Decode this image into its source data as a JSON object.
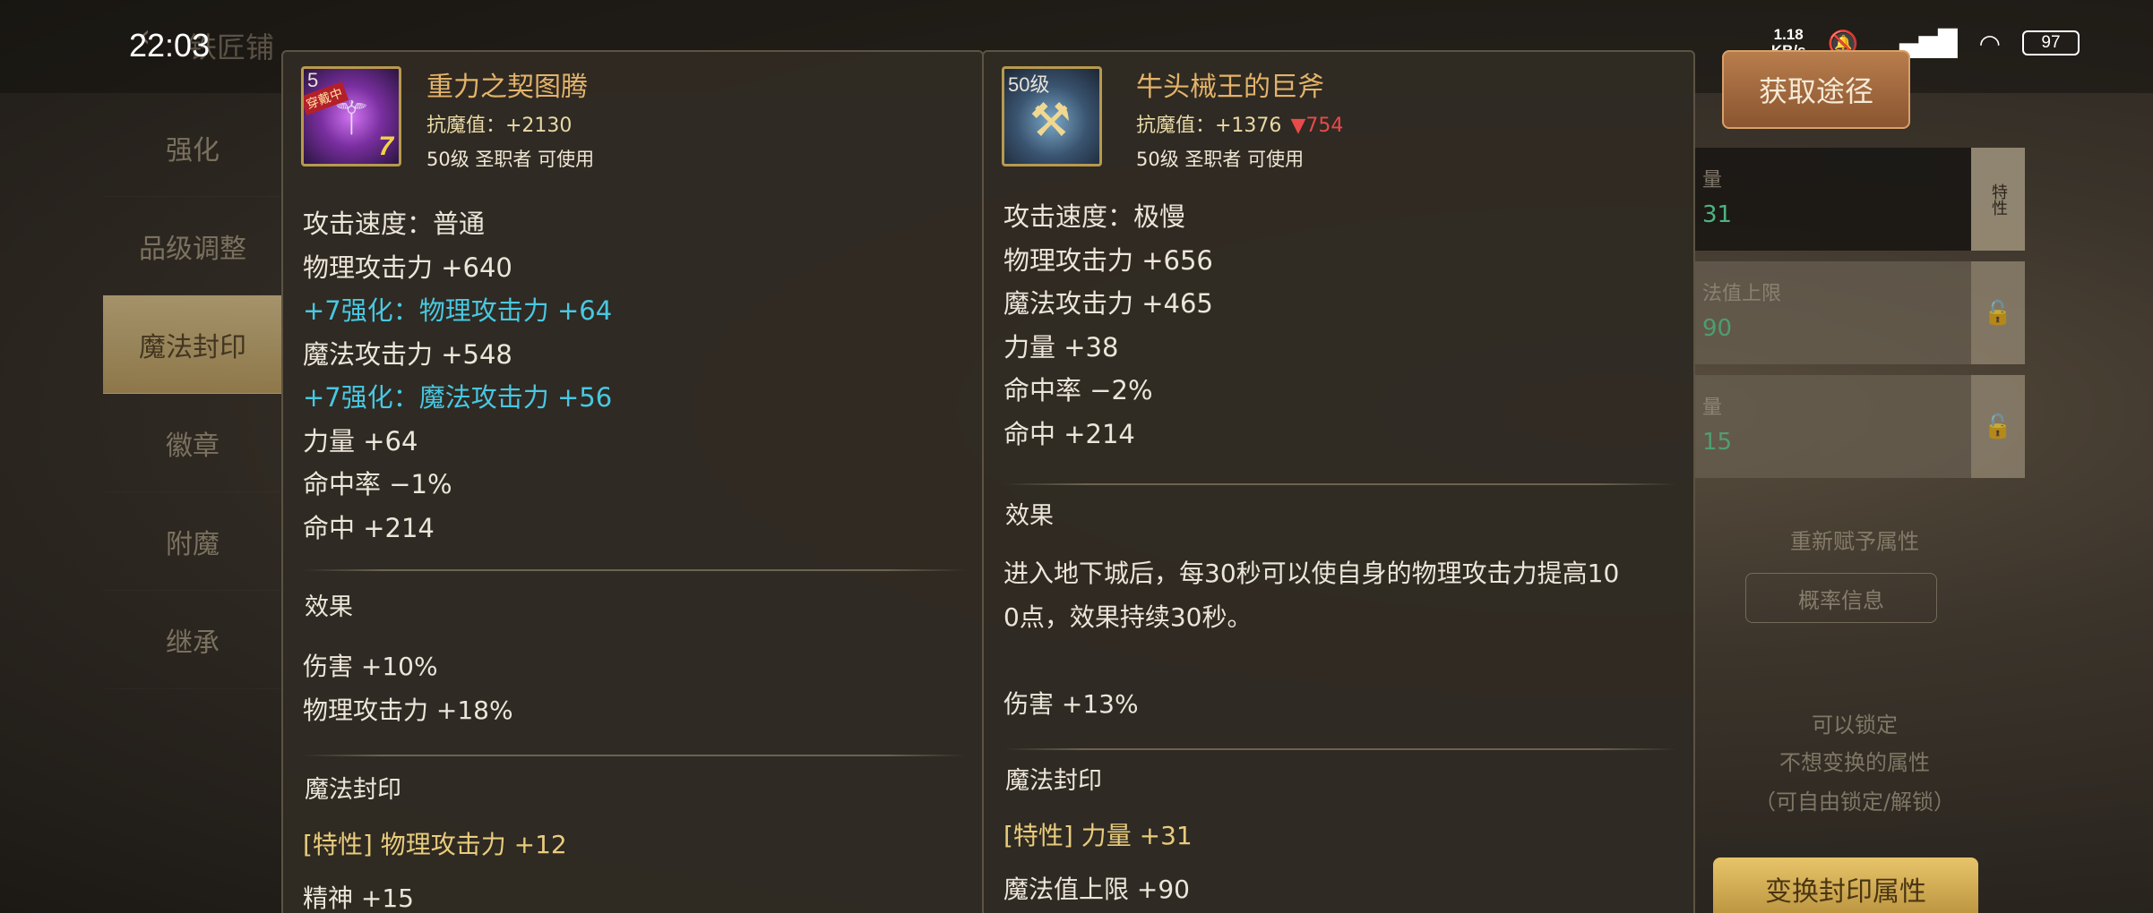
{
  "status_bar": {
    "time": "22:03",
    "net_speed_value": "1.18",
    "net_speed_unit": "KB/s",
    "battery": "97"
  },
  "background": {
    "title": "铁匠铺",
    "menu": [
      "强化",
      "品级调整",
      "魔法封印",
      "徽章",
      "附魔",
      "继承"
    ],
    "active_menu_index": 2,
    "get_source_button": "获取途径",
    "right_panel": {
      "rows": [
        {
          "label": "量",
          "value": "31"
        },
        {
          "label": "法值上限",
          "value": "90"
        },
        {
          "label": "量",
          "value": "15"
        }
      ],
      "side_tag": "特性",
      "reassign_text": "重新赋予属性",
      "prob_button": "概率信息",
      "lock_hint_1": "可以锁定",
      "lock_hint_2": "不想变换的属性",
      "lock_hint_3": "（可自由锁定/解锁）",
      "change_button": "变换封印属性"
    }
  },
  "left_item": {
    "icon_level": "5",
    "icon_tag": "穿戴中",
    "icon_plus": "7",
    "name": "重力之契图腾",
    "resist": "抗魔值：+2130",
    "class_line": "50级 圣职者 可使用",
    "stats": [
      {
        "text": "攻击速度：普通",
        "color": "white"
      },
      {
        "text": "物理攻击力 +640",
        "color": "white"
      },
      {
        "text": "+7强化：物理攻击力 +64",
        "color": "cyan"
      },
      {
        "text": "魔法攻击力 +548",
        "color": "white"
      },
      {
        "text": "+7强化：魔法攻击力 +56",
        "color": "cyan"
      },
      {
        "text": "力量 +64",
        "color": "white"
      },
      {
        "text": "命中率 −1%",
        "color": "white"
      },
      {
        "text": "命中 +214",
        "color": "white"
      }
    ],
    "effect_title": "效果",
    "effects": [
      "伤害 +10%",
      "物理攻击力 +18%"
    ],
    "seal_title": "魔法封印",
    "seal_lines": [
      {
        "text": "[特性] 物理攻击力 +12",
        "style": "gold"
      },
      {
        "text": "精神 +15",
        "style": "plain"
      }
    ]
  },
  "right_item": {
    "icon_level": "50级",
    "name": "牛头械王的巨斧",
    "resist_value": "抗魔值：+1376",
    "resist_diff": "▼754",
    "class_line": "50级 圣职者 可使用",
    "stats": [
      "攻击速度：极慢",
      "物理攻击力 +656",
      "魔法攻击力 +465",
      "力量 +38",
      "命中率 −2%",
      "命中 +214"
    ],
    "effect_title": "效果",
    "effect_desc_line1": "进入地下城后，每30秒可以使自身的物理攻击力提高10",
    "effect_desc_line2": "0点，效果持续30秒。",
    "effect_extra": "伤害 +13%",
    "seal_title": "魔法封印",
    "seal_lines": [
      {
        "text": "[特性] 力量 +31",
        "style": "gold"
      },
      {
        "text": "魔法值上限 +90",
        "style": "plain"
      }
    ]
  },
  "colors": {
    "cyan": "#48c8e2",
    "gold_name": "#e3b36a",
    "red_diff": "#e84a4a",
    "seal_gold": "#e9cc7c"
  }
}
